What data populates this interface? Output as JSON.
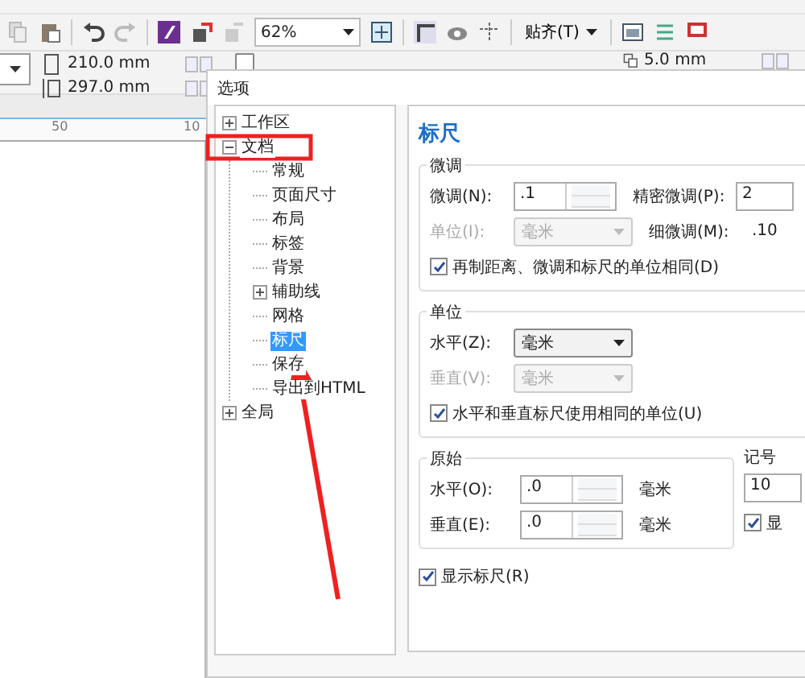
{
  "toolbar": {
    "zoom": "62%",
    "snap": "贴齐(T)"
  },
  "property_bar": {
    "width": "210.0 mm",
    "height": "297.0 mm",
    "offset": "5.0 mm"
  },
  "ruler": {
    "labels": [
      "50",
      "10"
    ]
  },
  "dialog": {
    "title": "选项",
    "tree": [
      {
        "label": "工作区",
        "expanded": false,
        "selected": false
      },
      {
        "label": "文档",
        "expanded": true,
        "selected": false,
        "children": [
          {
            "label": "常规",
            "selected": false
          },
          {
            "label": "页面尺寸",
            "selected": false
          },
          {
            "label": "布局",
            "selected": false
          },
          {
            "label": "标签",
            "selected": false
          },
          {
            "label": "背景",
            "selected": false
          },
          {
            "label": "辅助线",
            "expanded": false,
            "selected": false
          },
          {
            "label": "网格",
            "selected": false
          },
          {
            "label": "标尺",
            "selected": true
          },
          {
            "label": "保存",
            "selected": false
          },
          {
            "label": "导出到HTML",
            "selected": false
          }
        ]
      },
      {
        "label": "全局",
        "expanded": false,
        "selected": false
      }
    ],
    "page": {
      "heading": "标尺",
      "groups": [
        {
          "kind": "wide",
          "title": "微调",
          "rows": [
            [
              {
                "kind": "label",
                "text": "微调(N):",
                "disabled": false
              },
              {
                "kind": "spinner",
                "value": ".1"
              },
              {
                "kind": "label",
                "text": "精密微调(P):",
                "disabled": false
              },
              {
                "kind": "field",
                "value": "2"
              }
            ],
            [
              {
                "kind": "label",
                "text": "单位(I):",
                "disabled": true
              },
              {
                "kind": "dropdown",
                "value": "毫米",
                "disabled": true
              },
              {
                "kind": "label",
                "text": "细微调(M):",
                "disabled": false
              },
              {
                "kind": "text",
                "text": ".10"
              }
            ],
            [
              {
                "kind": "checkbox",
                "label": "再制距离、微调和标尺的单位相同(D)",
                "checked": true
              }
            ]
          ]
        },
        {
          "kind": "wide",
          "title": "单位",
          "rows": [
            [
              {
                "kind": "label",
                "text": "水平(Z):",
                "disabled": false
              },
              {
                "kind": "dropdown",
                "value": "毫米",
                "disabled": false
              }
            ],
            [
              {
                "kind": "label",
                "text": "垂直(V):",
                "disabled": true
              },
              {
                "kind": "dropdown",
                "value": "毫米",
                "disabled": true
              }
            ],
            [
              {
                "kind": "checkbox",
                "label": "水平和垂直标尺使用相同的单位(U)",
                "checked": true
              }
            ]
          ]
        },
        {
          "kind": "half",
          "title": "原始",
          "rows": [
            [
              {
                "kind": "label",
                "text": "水平(O):",
                "disabled": false
              },
              {
                "kind": "spinner",
                "value": ".0"
              },
              {
                "kind": "text",
                "text": "毫米"
              }
            ],
            [
              {
                "kind": "label",
                "text": "垂直(E):",
                "disabled": false
              },
              {
                "kind": "spinner",
                "value": ".0"
              },
              {
                "kind": "text",
                "text": "毫米"
              }
            ]
          ]
        },
        {
          "kind": "side",
          "title": "记号",
          "rows": [
            [
              {
                "kind": "field",
                "value": "10"
              }
            ],
            [
              {
                "kind": "checkbox",
                "label": "显",
                "checked": true
              }
            ]
          ]
        }
      ],
      "show_ruler": {
        "label": "显示标尺(R)",
        "checked": true
      }
    }
  }
}
